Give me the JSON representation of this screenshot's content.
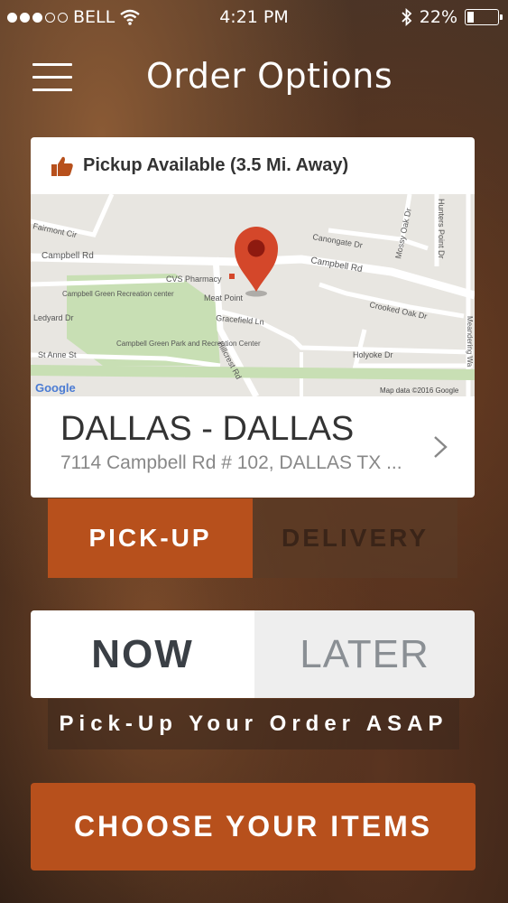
{
  "status_bar": {
    "carrier": "BELL",
    "time": "4:21 PM",
    "battery": "22%",
    "battery_level": 0.22,
    "icons": [
      "signal-dots-icon",
      "wifi-icon",
      "bluetooth-icon",
      "battery-icon"
    ]
  },
  "nav": {
    "title": "Order Options",
    "menu_icon": "hamburger-menu-icon"
  },
  "store_card": {
    "availability": "Pickup Available (3.5 Mi. Away)",
    "availability_icon": "thumbs-up-icon",
    "store_name": "DALLAS - DALLAS",
    "store_address": "7114 Campbell Rd # 102, DALLAS TX ...",
    "chevron_icon": "chevron-right-icon"
  },
  "map": {
    "labels": {
      "fairmont": "Fairmont Cir",
      "canongate": "Canongate Dr",
      "mossy": "Mossy Oak Dr",
      "hunters": "Hunters Point Dr",
      "campbell1": "Campbell Rd",
      "campbell2": "Campbell Rd",
      "cvs": "CVS Pharmacy",
      "green": "Campbell Green Recreation center",
      "ledyard": "Ledyard Dr",
      "meat": "Meat Point",
      "gracefield": "Gracefield Ln",
      "crooked": "Crooked Oak Dr",
      "meandering": "Meandering Wa",
      "stanne": "St Anne St",
      "park": "Campbell Green Park and Recreation Center",
      "hillcrest": "Hillcrest Rd",
      "holyoke": "Holyoke Dr",
      "attribution": "Map data ©2016 Google",
      "google": "Google"
    },
    "pin_icon": "map-pin-icon",
    "colors": {
      "pin": "#d4472a",
      "park": "#c8dfb4",
      "road": "#ffffff"
    }
  },
  "order_method": {
    "pickup_label": "PICK-UP",
    "delivery_label": "DELIVERY",
    "selected": "PICK-UP"
  },
  "order_time": {
    "now_label": "NOW",
    "later_label": "LATER",
    "selected": "NOW",
    "note": "Pick-Up Your Order ASAP"
  },
  "cta": {
    "label": "CHOOSE YOUR ITEMS"
  },
  "colors": {
    "accent": "#b7501c",
    "card": "#ffffff"
  }
}
